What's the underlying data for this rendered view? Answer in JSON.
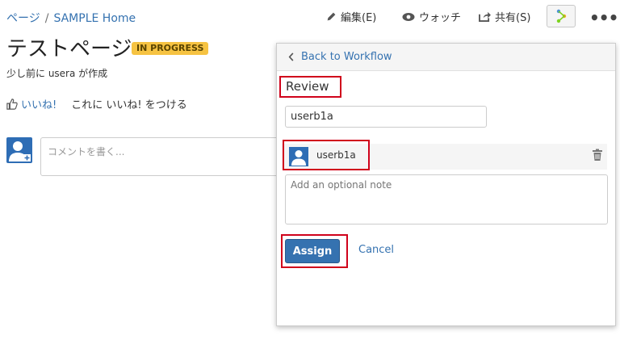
{
  "breadcrumb": {
    "spaces": "ページ",
    "separator": "/",
    "home": "SAMPLE Home"
  },
  "toolbar": {
    "edit_label": "編集(E)",
    "watch_label": "ウォッチ",
    "share_label": "共有(S)",
    "more_label": "•••"
  },
  "page": {
    "title": "テストページ",
    "status": "IN PROGRESS",
    "byline": "少し前に usera が作成",
    "like_label": "いいね!",
    "like_prompt": "これに いいね! をつける",
    "comment_placeholder": "コメントを書く..."
  },
  "workflow_panel": {
    "back_label": "Back to Workflow",
    "step_title": "Review",
    "user_input_value": "userb1a",
    "assignee_name": "userb1a",
    "note_placeholder": "Add an optional note",
    "assign_label": "Assign",
    "cancel_label": "Cancel"
  },
  "colors": {
    "link": "#3572b0",
    "status_bg": "#f6c342",
    "primary_button": "#3572b0",
    "highlight": "#d0021b"
  },
  "icons": [
    "pencil-icon",
    "eye-icon",
    "share-icon",
    "workflow-icon",
    "more-icon",
    "thumbs-up-icon",
    "avatar-icon",
    "trash-icon",
    "chevron-left-icon"
  ]
}
